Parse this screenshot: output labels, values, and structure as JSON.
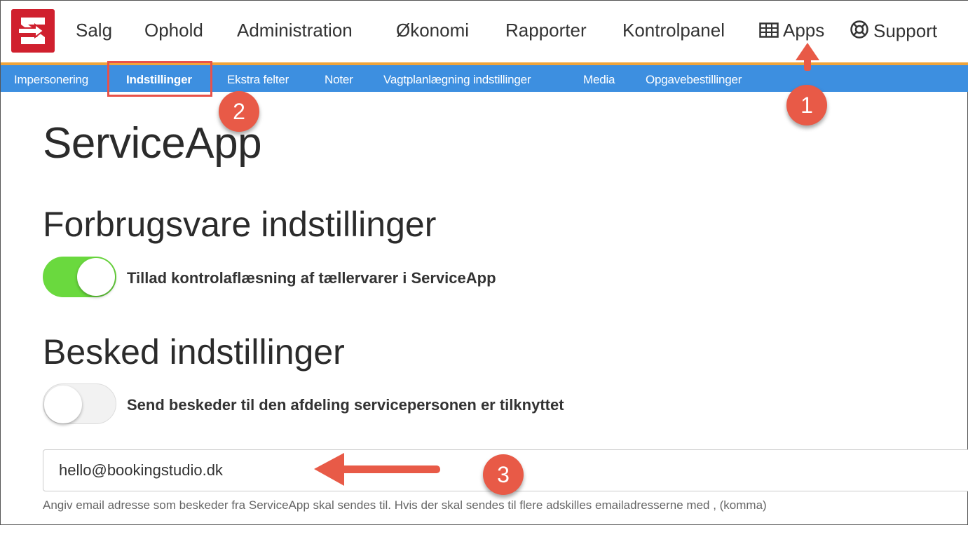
{
  "main_nav": {
    "sales": "Salg",
    "stay": "Ophold",
    "administration": "Administration",
    "economy": "Økonomi",
    "reports": "Rapporter",
    "control_panel": "Kontrolpanel",
    "apps": "Apps",
    "support": "Support"
  },
  "sub_nav": {
    "impersonation": "Impersonering",
    "settings": "Indstillinger",
    "extra_fields": "Ekstra felter",
    "notes": "Noter",
    "shift_settings": "Vagtplanlægning indstillinger",
    "media": "Media",
    "task_orders": "Opgavebestillinger"
  },
  "page": {
    "title": "ServiceApp",
    "consumables_heading": "Forbrugsvare indstillinger",
    "consumables_toggle_label": "Tillad kontrolaflæsning af tællervarer i ServiceApp",
    "consumables_toggle_on": true,
    "message_heading": "Besked indstillinger",
    "message_toggle_label": "Send beskeder til den afdeling servicepersonen er tilknyttet",
    "message_toggle_on": false,
    "email_value": "hello@bookingstudio.dk",
    "email_help": "Angiv email adresse som beskeder fra ServiceApp skal sendes til. Hvis der skal sendes til flere adskilles emailadresserne med , (komma)"
  },
  "annotations": {
    "badge_1": "1",
    "badge_2": "2",
    "badge_3": "3",
    "color": "#e85a47"
  },
  "colors": {
    "brand_red": "#d0202e",
    "subnav_blue": "#3d8fe0",
    "accent_orange": "#f0a43a",
    "toggle_green": "#6ad93e"
  }
}
